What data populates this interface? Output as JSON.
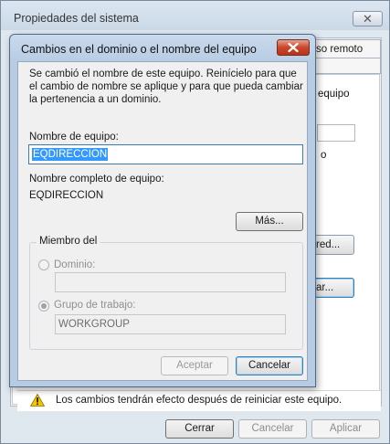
{
  "background_window": {
    "title": "Propiedades del sistema",
    "tab_remote": "so remoto",
    "fragments": {
      "equipo": "equipo",
      "o": "o",
      "red": "red...",
      "ar": "ar..."
    },
    "warning_text": "Los cambios tendrán efecto después de reiniciar este equipo.",
    "buttons": {
      "close": "Cerrar",
      "cancel": "Cancelar",
      "apply": "Aplicar"
    }
  },
  "dialog": {
    "title": "Cambios en el dominio o el nombre del equipo",
    "message": "Se cambió el nombre de este equipo. Reinícielo para que el cambio de nombre se aplique y para que pueda cambiar la pertenencia a un dominio.",
    "computer_name_label": "Nombre de equipo:",
    "computer_name_value": "EQDIRECCION",
    "full_name_label": "Nombre completo de equipo:",
    "full_name_value": "EQDIRECCION",
    "more_button": "Más...",
    "member_group": {
      "legend": "Miembro del",
      "domain_label": "Dominio:",
      "domain_value": "",
      "workgroup_label": "Grupo de trabajo:",
      "workgroup_value": "WORKGROUP",
      "selected": "workgroup"
    },
    "ok_button": "Aceptar",
    "cancel_button": "Cancelar"
  },
  "colors": {
    "selection": "#3399ff",
    "close_button": "#c9452b",
    "dialog_frame": "#b7cce3"
  },
  "icons": [
    "close-icon",
    "warning-icon"
  ]
}
